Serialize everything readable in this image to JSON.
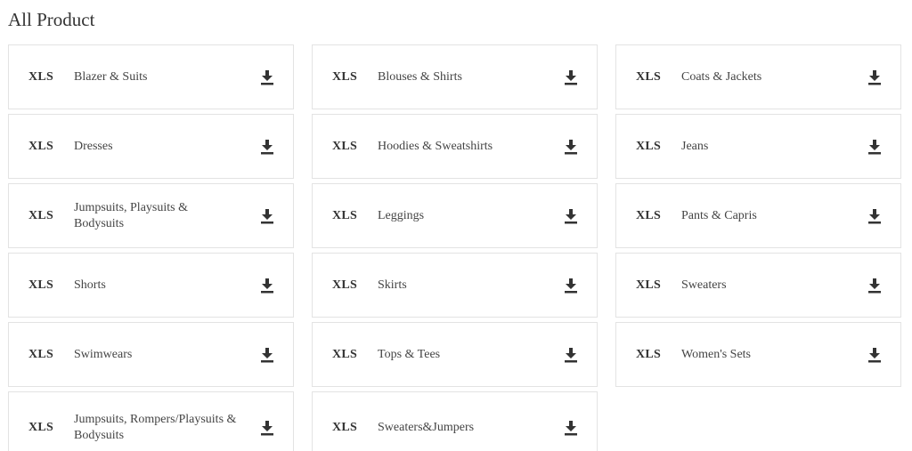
{
  "page": {
    "title": "All Product"
  },
  "file_type_label": "XLS",
  "icons": {
    "download": "download-icon"
  },
  "products": [
    {
      "name": "Blazer & Suits"
    },
    {
      "name": "Blouses & Shirts"
    },
    {
      "name": "Coats & Jackets"
    },
    {
      "name": "Dresses"
    },
    {
      "name": "Hoodies & Sweatshirts"
    },
    {
      "name": "Jeans"
    },
    {
      "name": "Jumpsuits, Playsuits & Bodysuits"
    },
    {
      "name": "Leggings"
    },
    {
      "name": "Pants & Capris"
    },
    {
      "name": "Shorts"
    },
    {
      "name": "Skirts"
    },
    {
      "name": "Sweaters"
    },
    {
      "name": "Swimwears"
    },
    {
      "name": "Tops & Tees"
    },
    {
      "name": "Women's Sets"
    },
    {
      "name": "Jumpsuits, Rompers/Playsuits & Bodysuits"
    },
    {
      "name": "Sweaters&Jumpers"
    }
  ]
}
